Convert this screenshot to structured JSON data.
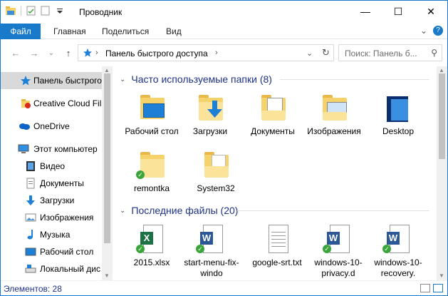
{
  "window": {
    "title": "Проводник",
    "controls": {
      "minimize": "—",
      "maximize": "☐",
      "close": "✕"
    }
  },
  "ribbon": {
    "tabs": [
      {
        "label": "Файл"
      },
      {
        "label": "Главная"
      },
      {
        "label": "Поделиться"
      },
      {
        "label": "Вид"
      }
    ],
    "expand": "⌄",
    "help": "?"
  },
  "navigation": {
    "back": "←",
    "forward": "→",
    "recent": "⌄",
    "up": "↑",
    "address": "Панель быстрого доступа",
    "separator": "›",
    "dropdown": "⌄",
    "refresh": "↻",
    "search_placeholder": "Поиск: Панель б...",
    "search_icon": "⚲"
  },
  "sidebar": {
    "items": [
      {
        "label": "Панель быстрого",
        "icon": "star-icon",
        "active": true
      },
      {
        "label": "Creative Cloud Fil",
        "icon": "creative-cloud-icon"
      },
      {
        "label": "OneDrive",
        "icon": "cloud-icon"
      },
      {
        "label": "Этот компьютер",
        "icon": "computer-icon"
      },
      {
        "label": "Видео",
        "icon": "video-icon"
      },
      {
        "label": "Документы",
        "icon": "documents-icon"
      },
      {
        "label": "Загрузки",
        "icon": "download-icon"
      },
      {
        "label": "Изображения",
        "icon": "pictures-icon"
      },
      {
        "label": "Музыка",
        "icon": "music-icon"
      },
      {
        "label": "Рабочий стол",
        "icon": "desktop-icon"
      },
      {
        "label": "Локальный дис",
        "icon": "drive-icon"
      }
    ]
  },
  "content": {
    "frequent": {
      "header": "Часто используемые папки (8)",
      "items": [
        {
          "label": "Рабочий стол",
          "icon": "desktop-folder-icon"
        },
        {
          "label": "Загрузки",
          "icon": "downloads-folder-icon"
        },
        {
          "label": "Документы",
          "icon": "documents-folder-icon"
        },
        {
          "label": "Изображения",
          "icon": "pictures-folder-icon"
        },
        {
          "label": "Desktop",
          "icon": "desktop-blue-folder-icon"
        },
        {
          "label": "remontka",
          "icon": "folder-synced-icon"
        },
        {
          "label": "System32",
          "icon": "folder-icon"
        }
      ]
    },
    "recent": {
      "header": "Последние файлы (20)",
      "items": [
        {
          "label": "2015.xlsx",
          "icon": "excel-file-icon"
        },
        {
          "label": "start-menu-fix-windo",
          "icon": "word-file-icon"
        },
        {
          "label": "google-srt.txt",
          "icon": "text-file-icon"
        },
        {
          "label": "windows-10-privacy.d",
          "icon": "word-file-icon"
        },
        {
          "label": "windows-10-recovery.",
          "icon": "word-file-icon"
        }
      ]
    }
  },
  "status": {
    "items_count": "Элементов: 28"
  },
  "colors": {
    "accent": "#1979ca",
    "header_text": "#1e3287",
    "folder": "#f6d36a",
    "sync_ok": "#3aa53a"
  }
}
